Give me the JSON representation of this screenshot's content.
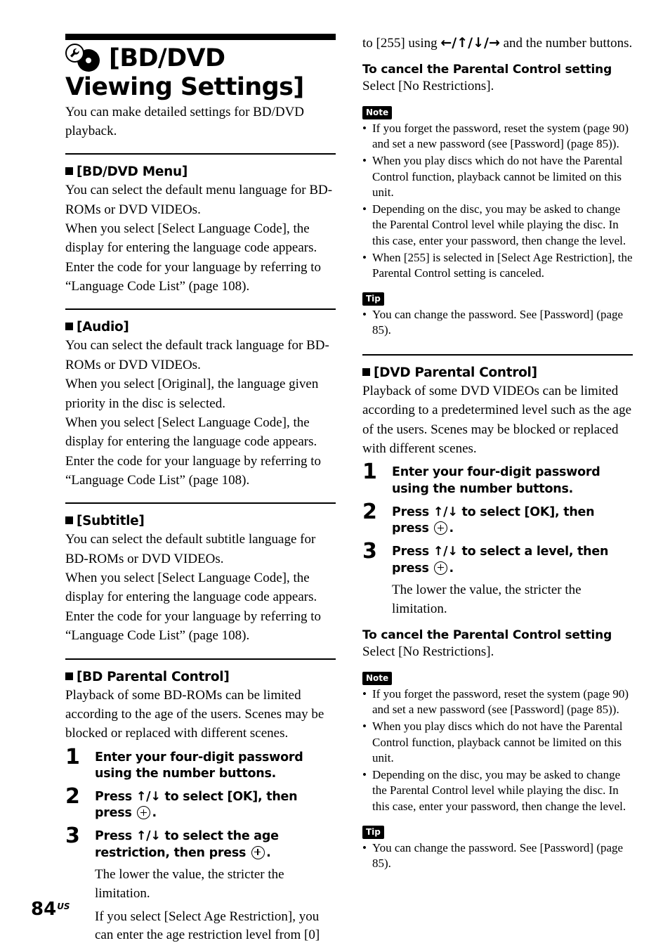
{
  "page": {
    "number": "84",
    "region_suffix": "US"
  },
  "title": {
    "text": "[BD/DVD Viewing Settings]",
    "icons": [
      "wrench-icon",
      "disc-icon"
    ]
  },
  "intro": "You can make detailed settings for BD/DVD playback.",
  "left_column": {
    "sections": [
      {
        "heading": "[BD/DVD Menu]",
        "paragraphs": [
          "You can select the default menu language for BD-ROMs or DVD VIDEOs.",
          "When you select [Select Language Code], the display for entering the language code appears. Enter the code for your language by referring to “Language Code List” (page 108)."
        ]
      },
      {
        "heading": "[Audio]",
        "paragraphs": [
          "You can select the default track language for BD-ROMs or DVD VIDEOs.",
          "When you select [Original], the language given priority in the disc is selected.",
          "When you select [Select Language Code], the display for entering the language code appears. Enter the code for your language by referring to “Language Code List” (page 108)."
        ]
      },
      {
        "heading": "[Subtitle]",
        "paragraphs": [
          "You can select the default subtitle language for BD-ROMs or DVD VIDEOs.",
          "When you select [Select Language Code], the display for entering the language code appears. Enter the code for your language by referring to “Language Code List” (page 108)."
        ]
      },
      {
        "heading": "[BD Parental Control]",
        "paragraphs": [
          "Playback of some BD-ROMs can be limited according to the age of the users. Scenes may be blocked or replaced with different scenes."
        ]
      }
    ],
    "steps": [
      {
        "number": "1",
        "text": "Enter your four-digit password using the number buttons.",
        "sub": []
      },
      {
        "number": "2",
        "text_before": "Press ↑/↓ to select [OK], then press",
        "text_after": ".",
        "sub": []
      },
      {
        "number": "3",
        "text_before": "Press ↑/↓ to select the age restriction, then press",
        "text_after": ".",
        "sub": [
          "The lower the value, the stricter the limitation.",
          "If you select [Select Age Restriction], you can enter the age restriction level from [0]"
        ]
      }
    ]
  },
  "right_column": {
    "continued_paragraph_before": "to [255] using ",
    "continued_arrows": "←/↑/↓/→",
    "continued_paragraph_after": " and the number buttons.",
    "cancel_heading_1": "To cancel the Parental Control setting",
    "cancel_body_1": "Select [No Restrictions].",
    "note_badge": "Note",
    "tip_badge": "Tip",
    "notes_1": [
      "If you forget the password, reset the system (page 90) and set a new password (see [Password] (page 85)).",
      "When you play discs which do not have the Parental Control function, playback cannot be limited on this unit.",
      "Depending on the disc, you may be asked to change the Parental Control level while playing the disc. In this case, enter your password, then change the level.",
      "When [255] is selected in [Select Age Restriction], the Parental Control setting is canceled."
    ],
    "tips_1": [
      "You can change the password. See [Password] (page 85)."
    ],
    "section": {
      "heading": "[DVD Parental Control]",
      "paragraphs": [
        "Playback of some DVD VIDEOs can be limited according to a predetermined level such as the age of the users. Scenes may be blocked or replaced with different scenes."
      ]
    },
    "steps": [
      {
        "number": "1",
        "text": "Enter your four-digit password using the number buttons.",
        "sub": []
      },
      {
        "number": "2",
        "text_before": "Press ↑/↓ to select [OK], then press",
        "text_after": ".",
        "sub": []
      },
      {
        "number": "3",
        "text_before": "Press ↑/↓ to select a level, then press",
        "text_after": ".",
        "sub": [
          "The lower the value, the stricter the limitation."
        ]
      }
    ],
    "cancel_heading_2": "To cancel the Parental Control setting",
    "cancel_body_2": "Select [No Restrictions].",
    "notes_2": [
      "If you forget the password, reset the system (page 90) and set a new password (see [Password] (page 85)).",
      "When you play discs which do not have the Parental Control function, playback cannot be limited on this unit.",
      "Depending on the disc, you may be asked to change the Parental Control level while playing the disc. In this case, enter your password, then change the level."
    ],
    "tips_2": [
      "You can change the password. See [Password] (page 85)."
    ]
  }
}
